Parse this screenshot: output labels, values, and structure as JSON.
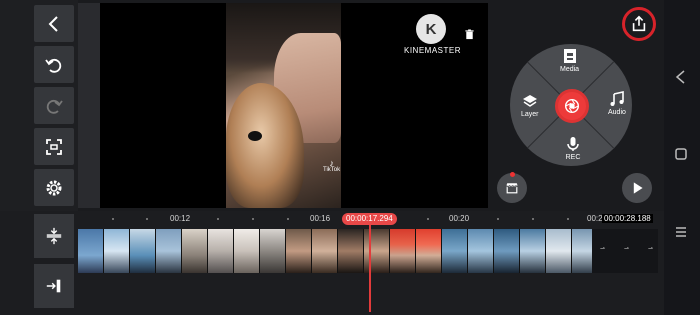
{
  "preview": {
    "brand": "KINEMASTER",
    "brand_mark": "K",
    "tiktok_caption": "TikTok"
  },
  "media_wheel": {
    "media_label": "Media",
    "layer_label": "Layer",
    "audio_label": "Audio",
    "rec_label": "REC"
  },
  "timeline": {
    "ticks": [
      "00:12",
      "00:16",
      "00:20",
      "00:2"
    ],
    "current_time": "00:00:17.294",
    "end_time": "00:00:28.188"
  },
  "icons": {
    "back": "back-arrow-icon",
    "undo": "undo-icon",
    "redo": "redo-icon",
    "fullscreen": "fullscreen-icon",
    "settings": "settings-gear-icon",
    "split": "split-icon",
    "jump_end": "jump-to-end-icon",
    "delete": "trash-icon",
    "export": "export-share-icon",
    "record": "camera-record-icon",
    "store": "asset-store-icon",
    "play": "play-icon"
  },
  "colors": {
    "accent": "#e84848",
    "export_ring": "#d8232a"
  }
}
